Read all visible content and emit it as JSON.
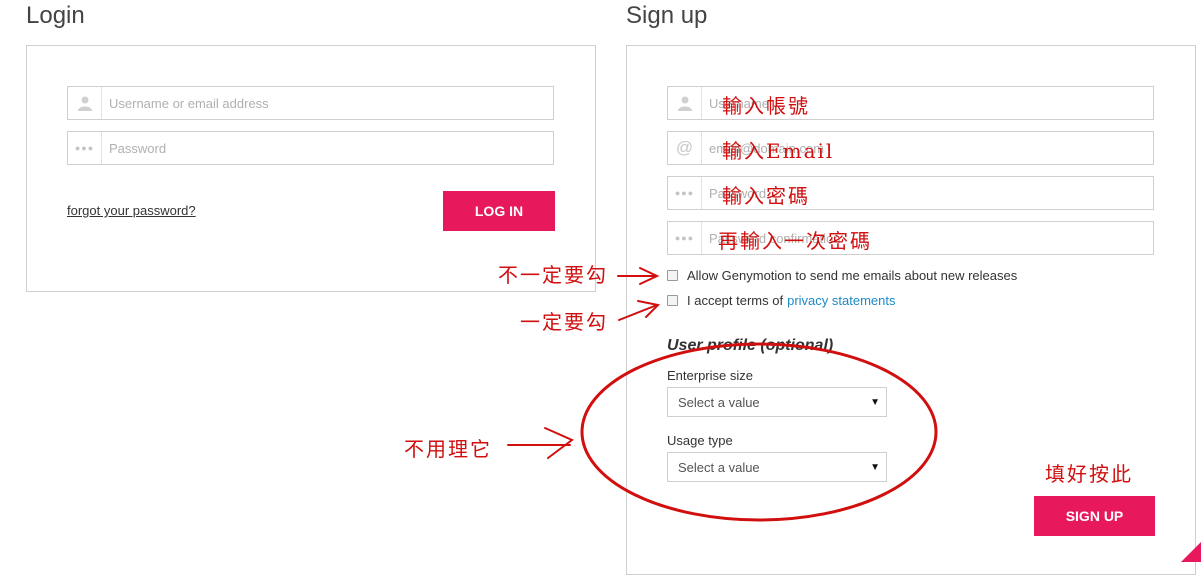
{
  "login": {
    "title": "Login",
    "username_placeholder": "Username or email address",
    "password_placeholder": "Password",
    "forgot_label": "forgot your password?",
    "login_button": "LOG IN"
  },
  "signup": {
    "title": "Sign up",
    "username_placeholder": "Username",
    "email_placeholder": "email@domain.com",
    "password_placeholder": "Password",
    "confirm_placeholder": "Password confirmation",
    "newsletter_label": "Allow Genymotion to send me emails about new releases",
    "terms_label": "I accept terms of",
    "terms_link": "privacy statements",
    "profile_title": "User profile (optional)",
    "enterprise_label": "Enterprise size",
    "enterprise_value": "Select a value",
    "usage_label": "Usage type",
    "usage_value": "Select a value",
    "signup_button": "SIGN UP"
  },
  "annotations": {
    "username": "輸入帳號",
    "email": "輸入Email",
    "password": "輸入密碼",
    "confirm": "再輸入一次密碼",
    "optional_check": "不一定要勾",
    "required_check": "一定要勾",
    "ignore": "不用理它",
    "click_here": "填好按此"
  },
  "icons": {
    "user": "user-icon",
    "at": "at-icon",
    "dots": "password-dots-icon"
  },
  "colors": {
    "accent": "#e8185c",
    "link": "#1d8ac6",
    "annotation": "#d10f0f"
  }
}
